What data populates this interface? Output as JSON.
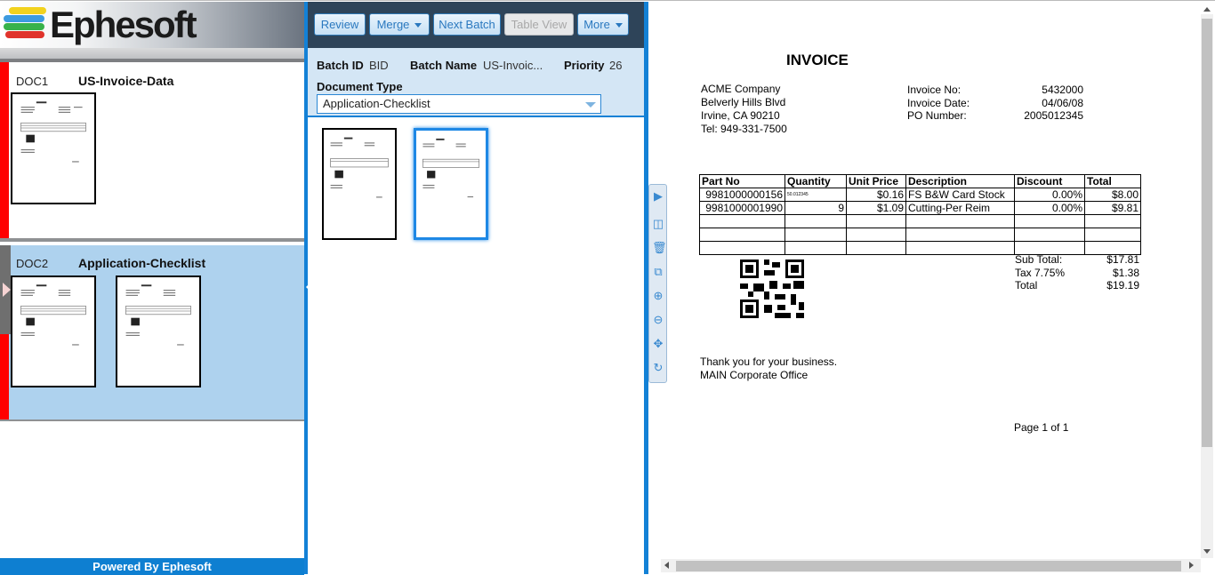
{
  "logo": {
    "text": "Ephesoft"
  },
  "colors": {
    "accent": "#1381d6",
    "doc_flag": "#ff0000",
    "selected_doc_bg": "#aed2ee",
    "toolbar_bg": "#2e4459"
  },
  "documents": [
    {
      "id": "DOC1",
      "name": "US-Invoice-Data"
    },
    {
      "id": "DOC2",
      "name": "Application-Checklist"
    }
  ],
  "footer": {
    "powered_by": "Powered By Ephesoft"
  },
  "toolbar": {
    "review": "Review",
    "merge": "Merge",
    "next_batch": "Next Batch",
    "table_view": "Table View",
    "more": "More"
  },
  "batch": {
    "batch_id_label": "Batch ID",
    "batch_id": "BID",
    "batch_name_label": "Batch Name",
    "batch_name": "US-Invoic...",
    "priority_label": "Priority",
    "priority": "26",
    "doc_type_label": "Document Type",
    "doc_type_value": "Application-Checklist"
  },
  "viewer_tools": [
    "play-icon",
    "split-icon",
    "trash-icon",
    "copy-icon",
    "zoom-in-icon",
    "zoom-out-icon",
    "move-icon",
    "rotate-icon"
  ],
  "invoice": {
    "title": "INVOICE",
    "company": [
      "ACME Company",
      "Belverly Hills Blvd",
      "Irvine, CA 90210",
      "Tel: 949-331-7500"
    ],
    "meta_labels": [
      "Invoice No:",
      "Invoice Date:",
      "PO Number:"
    ],
    "meta_values": [
      "5432000",
      "04/06/08",
      "2005012345"
    ],
    "table_headers": [
      "Part No",
      "Quantity",
      "Unit Price",
      "Description",
      "Discount",
      "Total"
    ],
    "rows": [
      [
        "9981000000156",
        "50.012345",
        "$0.16",
        "FS B&W Card Stock",
        "0.00%",
        "$8.00"
      ],
      [
        "9981000001990",
        "9",
        "$1.09",
        "Cutting-Per Reim",
        "0.00%",
        "$9.81"
      ]
    ],
    "totals_labels": [
      "Sub Total:",
      "Tax 7.75%",
      "Total"
    ],
    "totals_values": [
      "$17.81",
      "$1.38",
      "$19.19"
    ],
    "thanks": "Thank you for your business.",
    "office": "MAIN Corporate Office",
    "page": "Page 1 of 1"
  }
}
